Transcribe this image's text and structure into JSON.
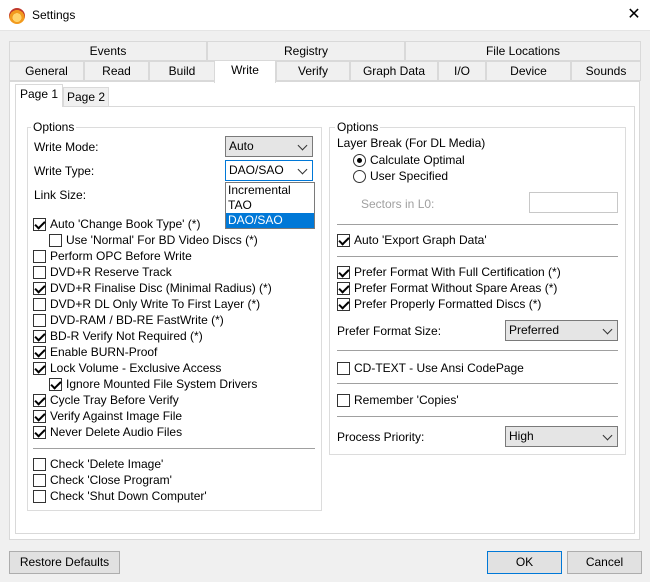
{
  "window": {
    "title": "Settings"
  },
  "tabs_row1": [
    "Events",
    "Registry",
    "File Locations"
  ],
  "tabs_row2": [
    "General",
    "Read",
    "Build",
    "Write",
    "Verify",
    "Graph Data",
    "I/O",
    "Device",
    "Sounds"
  ],
  "active_tab": "Write",
  "page_tabs": [
    "Page 1",
    "Page 2"
  ],
  "left": {
    "group_label": "Options",
    "write_mode_label": "Write Mode:",
    "write_mode_value": "Auto",
    "write_type_label": "Write Type:",
    "write_type_value": "DAO/SAO",
    "write_type_options": [
      "Incremental",
      "TAO",
      "DAO/SAO"
    ],
    "link_size_label": "Link Size:",
    "checks": [
      {
        "label": "Auto 'Change Book Type' (*)",
        "checked": true
      },
      {
        "label": "Use 'Normal' For BD Video Discs (*)",
        "checked": false
      },
      {
        "label": "Perform OPC Before Write",
        "checked": false
      },
      {
        "label": "DVD+R Reserve Track",
        "checked": false
      },
      {
        "label": "DVD+R Finalise Disc (Minimal Radius) (*)",
        "checked": true
      },
      {
        "label": "DVD+R DL Only Write To First Layer (*)",
        "checked": false
      },
      {
        "label": "DVD-RAM / BD-RE FastWrite (*)",
        "checked": false
      },
      {
        "label": "BD-R Verify Not Required (*)",
        "checked": true
      },
      {
        "label": "Enable BURN-Proof",
        "checked": true
      },
      {
        "label": "Lock Volume - Exclusive Access",
        "checked": true
      },
      {
        "label": "Ignore Mounted File System Drivers",
        "checked": true
      },
      {
        "label": "Cycle Tray Before Verify",
        "checked": true
      },
      {
        "label": "Verify Against Image File",
        "checked": true
      },
      {
        "label": "Never Delete Audio Files",
        "checked": true
      }
    ],
    "checks2": [
      {
        "label": "Check 'Delete Image'",
        "checked": false
      },
      {
        "label": "Check 'Close Program'",
        "checked": false
      },
      {
        "label": "Check 'Shut Down Computer'",
        "checked": false
      }
    ]
  },
  "right": {
    "group_label": "Options",
    "layer_break_label": "Layer Break (For DL Media)",
    "radio_calc": "Calculate Optimal",
    "radio_user": "User Specified",
    "sectors_label": "Sectors in L0:",
    "sectors_value": "",
    "auto_export": {
      "label": "Auto 'Export Graph Data'",
      "checked": true
    },
    "prefs": [
      {
        "label": "Prefer Format With Full Certification (*)",
        "checked": true
      },
      {
        "label": "Prefer Format Without Spare Areas (*)",
        "checked": true
      },
      {
        "label": "Prefer Properly Formatted Discs (*)",
        "checked": true
      }
    ],
    "format_size_label": "Prefer Format Size:",
    "format_size_value": "Preferred",
    "cdtext": {
      "label": "CD-TEXT - Use Ansi CodePage",
      "checked": false
    },
    "remember": {
      "label": "Remember 'Copies'",
      "checked": false
    },
    "priority_label": "Process Priority:",
    "priority_value": "High"
  },
  "buttons": {
    "restore": "Restore Defaults",
    "ok": "OK",
    "cancel": "Cancel"
  }
}
